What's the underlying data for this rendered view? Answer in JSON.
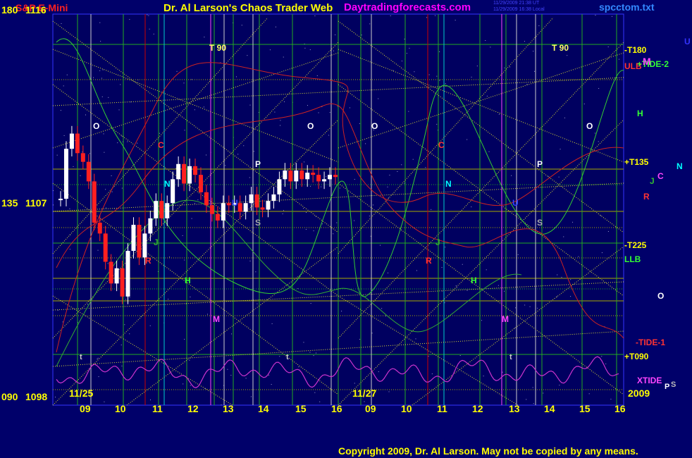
{
  "header": {
    "symbol": "S&P E-Mini",
    "title": "Dr. Al Larson's Chaos Trader Web",
    "site": "Daytradingforecasts.com",
    "time_ut": "11/29/2009 21:38 UT",
    "time_local": "11/29/2009 16:38 Local",
    "file": "spcctom.txt"
  },
  "footer": {
    "copyright": "Copyright 2009, Dr. Al Larson. May not be copied by any means."
  },
  "colors": {
    "background": "#00006a",
    "plot_bg": "#000060",
    "axis_text": "#ffff00",
    "price_up": "#ffffff",
    "price_down": "#ff2020",
    "tide": "#cc0000",
    "xtide": "#cc33cc",
    "flux_green": "#22cc22",
    "grid_yellow": "#cccc00",
    "logo_magenta": "#ff00ff"
  },
  "chart_data": {
    "type": "line",
    "title": "S&P E-Mini",
    "y_axis": {
      "range": [
        1098,
        1116
      ],
      "tick_labels": [
        {
          "harmonic": "180",
          "price": "1116",
          "value": 1116
        },
        {
          "harmonic": "135",
          "price": "1107",
          "value": 1107
        },
        {
          "harmonic": "090",
          "price": "1098",
          "value": 1098
        }
      ]
    },
    "x_axis": {
      "hours": [
        "09",
        "10",
        "11",
        "12",
        "13",
        "14",
        "15",
        "16",
        "09",
        "10",
        "11",
        "12",
        "13",
        "14",
        "15",
        "16"
      ],
      "dates": [
        "11/25",
        "11/27"
      ],
      "year": "2009"
    },
    "right_labels": [
      {
        "text": "-T180",
        "color": "#ffff00"
      },
      {
        "text": "ULB",
        "color": "#ff3333"
      },
      {
        "text": "+TIDE-2",
        "color": "#33ff33"
      },
      {
        "text": "+T135",
        "color": "#ffff00"
      },
      {
        "text": "-T225",
        "color": "#ffff00"
      },
      {
        "text": "LLB",
        "color": "#33ff33"
      },
      {
        "text": "-TIDE-1",
        "color": "#ff3333"
      },
      {
        "text": "+T090",
        "color": "#ffff00"
      },
      {
        "text": "XTIDE",
        "color": "#ff44ff"
      }
    ],
    "planet_legend": [
      {
        "text": "U",
        "color": "#3333ff"
      },
      {
        "text": "M",
        "color": "#ff44ff"
      },
      {
        "text": "H",
        "color": "#33ff33"
      },
      {
        "text": "N",
        "color": "#00ffff"
      },
      {
        "text": "C",
        "color": "#ff44ff"
      },
      {
        "text": "J",
        "color": "#33bb33"
      },
      {
        "text": "R",
        "color": "#ff3333"
      },
      {
        "text": "O",
        "color": "#ffffff"
      },
      {
        "text": "P",
        "color": "#ffffff"
      },
      {
        "text": "S",
        "color": "#bbbbbb"
      }
    ],
    "chart_markers": [
      {
        "text": "T 90",
        "color": "#ffff66"
      },
      {
        "text": "T 90",
        "color": "#ffff66"
      },
      {
        "text": "O",
        "color": "#ffffff"
      },
      {
        "text": "O",
        "color": "#ffffff"
      },
      {
        "text": "O",
        "color": "#ffffff"
      },
      {
        "text": "O",
        "color": "#ffffff"
      },
      {
        "text": "C",
        "color": "#ff3333"
      },
      {
        "text": "C",
        "color": "#ff3333"
      },
      {
        "text": "N",
        "color": "#00ffff"
      },
      {
        "text": "N",
        "color": "#00ffff"
      },
      {
        "text": "P",
        "color": "#ffffff"
      },
      {
        "text": "P",
        "color": "#ffffff"
      },
      {
        "text": "U",
        "color": "#3344ff"
      },
      {
        "text": "U",
        "color": "#3344ff"
      },
      {
        "text": "S",
        "color": "#aaaaaa"
      },
      {
        "text": "S",
        "color": "#aaaaaa"
      },
      {
        "text": "J",
        "color": "#33aa33"
      },
      {
        "text": "J",
        "color": "#33aa33"
      },
      {
        "text": "R",
        "color": "#ff3333"
      },
      {
        "text": "R",
        "color": "#ff3333"
      },
      {
        "text": "H",
        "color": "#33ff33"
      },
      {
        "text": "H",
        "color": "#33ff33"
      },
      {
        "text": "M",
        "color": "#ff44ff"
      },
      {
        "text": "M",
        "color": "#ff44ff"
      },
      {
        "text": "t",
        "color": "#cccccc"
      },
      {
        "text": "t",
        "color": "#cccccc"
      },
      {
        "text": "t",
        "color": "#cccccc"
      }
    ],
    "price_series": {
      "name": "S&P E-Mini",
      "session": "11/25",
      "values": [
        1107.5,
        1109.8,
        1110.5,
        1109.6,
        1109.2,
        1108.3,
        1106.4,
        1105.9,
        1104.6,
        1103.6,
        1104.3,
        1103.0,
        1105.1,
        1106.3,
        1104.8,
        1105.9,
        1106.6,
        1107.4,
        1106.6,
        1107.3,
        1108.4,
        1109.1,
        1108.2,
        1109.0,
        1108.6,
        1107.8,
        1107.2,
        1106.8,
        1106.5,
        1107.3,
        1107.2,
        1107.3,
        1106.9,
        1107.3,
        1107.7,
        1107.1,
        1107.0,
        1107.4,
        1107.7,
        1108.4,
        1108.8,
        1108.3,
        1108.8,
        1108.4,
        1108.7,
        1108.6,
        1108.3,
        1108.4,
        1108.6,
        1108.5
      ]
    },
    "tide_series": {
      "name": "TIDE"
    },
    "xtide_series": {
      "name": "XTIDE"
    }
  }
}
